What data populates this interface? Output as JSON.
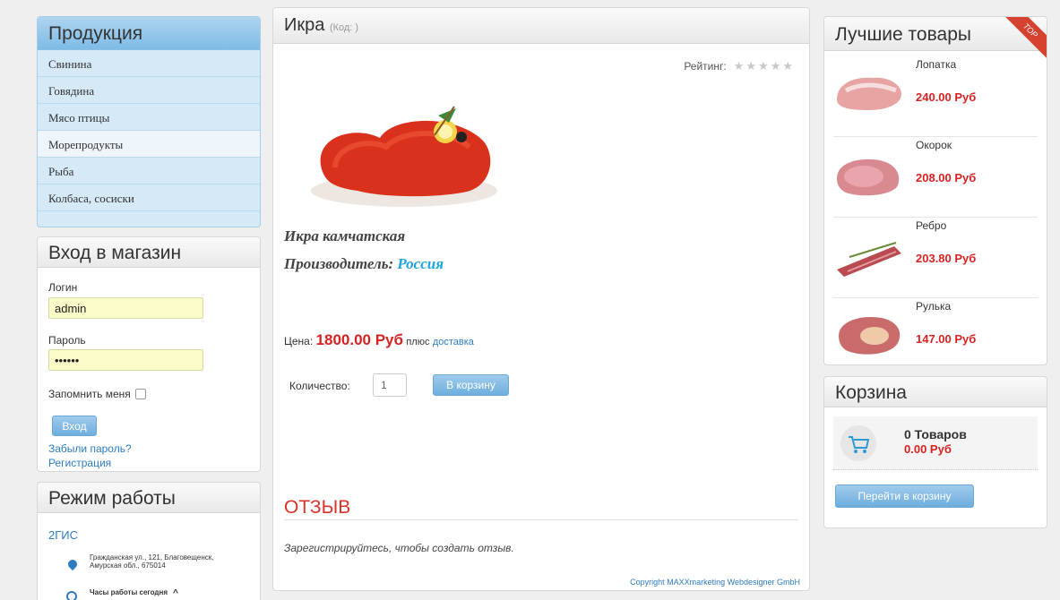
{
  "sidebar": {
    "products_title": "Продукция",
    "items": [
      {
        "label": "Свинина"
      },
      {
        "label": "Говядина"
      },
      {
        "label": "Мясо птицы"
      },
      {
        "label": "Морепродукты"
      },
      {
        "label": "Рыба"
      },
      {
        "label": "Колбаса, сосиски"
      }
    ],
    "login": {
      "title": "Вход в магазин",
      "login_label": "Логин",
      "login_value": "admin",
      "password_label": "Пароль",
      "password_value": "••••••",
      "remember_label": "Запомнить меня",
      "submit_label": "Вход",
      "forgot_label": "Забыли пароль?",
      "register_label": "Регистрация"
    },
    "hours": {
      "title": "Режим работы",
      "provider": "2ГИС",
      "address": "Гражданская ул., 121, Благовещенск, Амурская обл., 675014",
      "hours_today": "Часы работы сегодня"
    }
  },
  "product": {
    "title": "Икра",
    "code": "(Код: )",
    "rating_label": "Рейтинг:",
    "rating_stars": 0,
    "name": "Икра камчатская",
    "manufacturer_label": "Производитель:",
    "manufacturer": "Россия",
    "price_label": "Цена:",
    "price": "1800.00 Руб",
    "plus_label": "плюс",
    "delivery_label": "доставка",
    "qty_label": "Количество:",
    "qty_value": "1",
    "add_to_cart": "В корзину",
    "review_title": "ОТЗЫВ",
    "review_note": "Зарегистрируйтесь, чтобы создать отзыв.",
    "copyright": "Copyright MAXXmarketing Webdesigner GmbH"
  },
  "best": {
    "title": "Лучшие товары",
    "ribbon": "TOP",
    "items": [
      {
        "name": "Лопатка",
        "price": "240.00 Руб"
      },
      {
        "name": "Окорок",
        "price": "208.00 Руб"
      },
      {
        "name": "Ребро",
        "price": "203.80 Руб"
      },
      {
        "name": "Рулька",
        "price": "147.00 Руб"
      }
    ]
  },
  "cart": {
    "title": "Корзина",
    "items_count": "0 Товаров",
    "total": "0.00 Руб",
    "goto_label": "Перейти в корзину"
  },
  "colors": {
    "accent": "#2d7cc1",
    "price": "#d72222",
    "manufacturer": "#1ea3dd",
    "review": "#d9322b",
    "ribbon": "#d64230"
  }
}
